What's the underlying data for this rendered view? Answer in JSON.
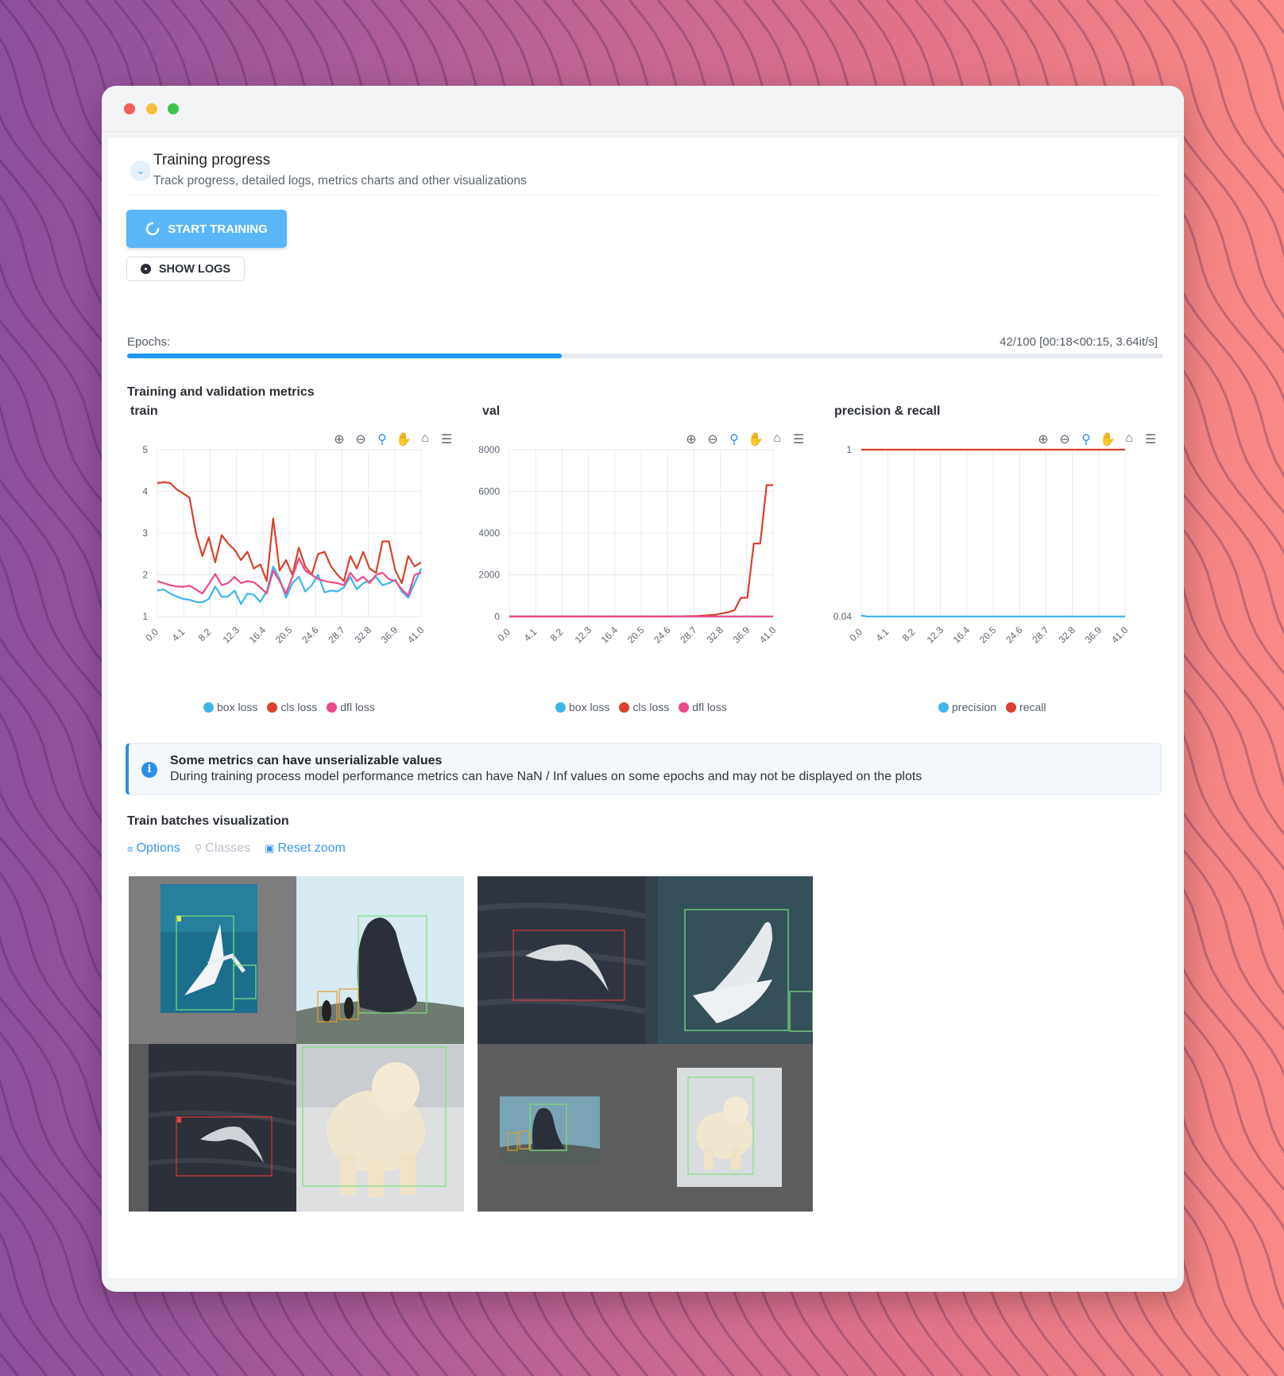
{
  "window": {
    "controls": [
      "close",
      "minimize",
      "maximize"
    ]
  },
  "section": {
    "title": "Training progress",
    "subtitle": "Track progress, detailed logs, metrics charts and other visualizations",
    "collapse_icon": "chevron-down-icon"
  },
  "buttons": {
    "start_training": "START TRAINING",
    "show_logs": "SHOW LOGS"
  },
  "progress": {
    "label": "Epochs:",
    "status": "42/100 [00:18<00:15, 3.64it/s]",
    "fraction": 0.42
  },
  "metrics": {
    "title": "Training and validation metrics"
  },
  "toolbar_icons": [
    "zoom-in-icon",
    "zoom-out-icon",
    "magnifier-icon",
    "pan-hand-icon",
    "home-icon",
    "menu-icon"
  ],
  "colors": {
    "accent": "#2196f3",
    "box_loss": "#3eb5ea",
    "cls_loss": "#d9412c",
    "dfl_loss": "#ec4a8a",
    "precision": "#3eb5ea",
    "recall": "#d9412c"
  },
  "chart_data": [
    {
      "type": "line",
      "title": "train",
      "x_ticks": [
        "0.0",
        "4.1",
        "8.2",
        "12.3",
        "16.4",
        "20.5",
        "24.6",
        "28.7",
        "32.8",
        "36.9",
        "41.0"
      ],
      "xlim": [
        0,
        41
      ],
      "y_ticks": [
        "1",
        "2",
        "3",
        "4",
        "5"
      ],
      "ylim": [
        1,
        5
      ],
      "grid": true,
      "legend": "bottom",
      "series": [
        {
          "name": "box loss",
          "color": "#3eb5ea",
          "values": [
            1.62,
            1.65,
            1.55,
            1.48,
            1.42,
            1.4,
            1.35,
            1.34,
            1.42,
            1.72,
            1.47,
            1.48,
            1.62,
            1.3,
            1.55,
            1.52,
            1.35,
            1.6,
            2.2,
            1.9,
            1.45,
            1.8,
            1.95,
            1.6,
            1.75,
            2.0,
            1.58,
            1.62,
            1.6,
            1.7,
            1.95,
            1.65,
            1.8,
            1.85,
            1.95,
            1.75,
            1.8,
            1.88,
            1.6,
            1.45,
            1.8,
            2.15
          ]
        },
        {
          "name": "cls loss",
          "color": "#d9412c",
          "values": [
            4.2,
            4.22,
            4.2,
            4.05,
            3.95,
            3.85,
            3.0,
            2.45,
            2.9,
            2.3,
            2.95,
            2.75,
            2.6,
            2.35,
            2.55,
            2.15,
            2.25,
            1.85,
            3.35,
            2.1,
            2.35,
            2.0,
            2.65,
            2.2,
            2.0,
            2.5,
            2.55,
            2.2,
            2.0,
            1.85,
            2.45,
            2.15,
            2.55,
            2.15,
            2.05,
            2.8,
            2.8,
            2.1,
            1.8,
            2.45,
            2.2,
            2.3
          ]
        },
        {
          "name": "dfl loss",
          "color": "#ec4a8a",
          "values": [
            1.85,
            1.8,
            1.75,
            1.72,
            1.71,
            1.74,
            1.65,
            1.55,
            1.78,
            2.02,
            1.75,
            1.8,
            1.95,
            1.8,
            1.85,
            1.82,
            1.7,
            1.55,
            2.1,
            1.85,
            1.55,
            1.95,
            2.4,
            2.1,
            2.0,
            1.9,
            1.85,
            1.82,
            1.8,
            1.75,
            2.05,
            1.85,
            1.95,
            1.8,
            2.0,
            2.05,
            1.9,
            1.85,
            1.65,
            1.5,
            2.0,
            2.05
          ]
        }
      ]
    },
    {
      "type": "line",
      "title": "val",
      "x_ticks": [
        "0.0",
        "4.1",
        "8.2",
        "12.3",
        "16.4",
        "20.5",
        "24.6",
        "28.7",
        "32.8",
        "36.9",
        "41.0"
      ],
      "xlim": [
        0,
        41
      ],
      "y_ticks": [
        "0",
        "2000",
        "4000",
        "6000",
        "8000"
      ],
      "ylim": [
        0,
        8000
      ],
      "grid": true,
      "legend": "bottom",
      "series": [
        {
          "name": "box loss",
          "color": "#3eb5ea",
          "values": [
            0,
            0,
            0,
            0,
            0,
            0,
            0,
            0,
            0,
            0,
            0,
            0,
            0,
            0,
            0,
            0,
            0,
            0,
            0,
            0,
            0,
            0,
            0,
            0,
            0,
            0,
            0,
            0,
            0,
            0,
            0,
            0,
            0,
            0,
            0,
            0,
            0,
            0,
            0,
            0,
            0,
            0
          ]
        },
        {
          "name": "cls loss",
          "color": "#d9412c",
          "values": [
            0,
            0,
            0,
            0,
            0,
            0,
            0,
            0,
            0,
            0,
            0,
            0,
            0,
            0,
            0,
            0,
            0,
            0,
            0,
            0,
            0,
            0,
            0,
            0,
            0,
            0,
            5,
            10,
            20,
            20,
            40,
            60,
            80,
            150,
            200,
            300,
            900,
            900,
            3500,
            3500,
            6300,
            6300
          ]
        },
        {
          "name": "dfl loss",
          "color": "#ec4a8a",
          "values": [
            0,
            0,
            0,
            0,
            0,
            0,
            0,
            0,
            0,
            0,
            0,
            0,
            0,
            0,
            0,
            0,
            0,
            0,
            0,
            0,
            0,
            0,
            0,
            0,
            0,
            0,
            0,
            0,
            0,
            0,
            0,
            0,
            0,
            0,
            0,
            0,
            0,
            0,
            0,
            0,
            0,
            0
          ]
        }
      ]
    },
    {
      "type": "line",
      "title": "precision & recall",
      "x_ticks": [
        "0.0",
        "4.1",
        "8.2",
        "12.3",
        "16.4",
        "20.5",
        "24.6",
        "28.7",
        "32.8",
        "36.9",
        "41.0"
      ],
      "xlim": [
        0,
        41
      ],
      "y_ticks": [
        "0.04",
        "1"
      ],
      "ylim": [
        0.04,
        1
      ],
      "grid": true,
      "legend": "bottom",
      "series": [
        {
          "name": "precision",
          "color": "#3eb5ea",
          "values": [
            0.045,
            0.04,
            0.04,
            0.04,
            0.04,
            0.04,
            0.04,
            0.04,
            0.04,
            0.04,
            0.04,
            0.04,
            0.04,
            0.04,
            0.04,
            0.04,
            0.04,
            0.04,
            0.04,
            0.04,
            0.04,
            0.04,
            0.04,
            0.04,
            0.04,
            0.04,
            0.04,
            0.04,
            0.04,
            0.04,
            0.04,
            0.04,
            0.04,
            0.04,
            0.04,
            0.04,
            0.04,
            0.04,
            0.04,
            0.04,
            0.04,
            0.04
          ]
        },
        {
          "name": "recall",
          "color": "#d9412c",
          "values": [
            1,
            1,
            1,
            1,
            1,
            1,
            1,
            1,
            1,
            1,
            1,
            1,
            1,
            1,
            1,
            1,
            1,
            1,
            1,
            1,
            1,
            1,
            1,
            1,
            1,
            1,
            1,
            1,
            1,
            1,
            1,
            1,
            1,
            1,
            1,
            1,
            1,
            1,
            1,
            1,
            1,
            1
          ]
        }
      ]
    }
  ],
  "notice": {
    "icon": "info-icon",
    "title": "Some metrics can have unserializable values",
    "text": "During training process model performance metrics can have NaN / Inf values on some epochs and may not be displayed on the plots"
  },
  "visualization": {
    "title": "Train batches visualization",
    "links": [
      {
        "label": "Options",
        "icon": "sliders-icon",
        "enabled": true
      },
      {
        "label": "Classes",
        "icon": "tags-icon",
        "enabled": false
      },
      {
        "label": "Reset zoom",
        "icon": "image-reset-icon",
        "enabled": true
      }
    ],
    "batches": [
      {
        "tiles": [
          "seagull",
          "seal-penguins",
          "seagull-dark",
          "polar-bear"
        ]
      },
      {
        "tiles": [
          "seagull-dark",
          "seagull-large",
          "seal-penguins-small",
          "polar-bear-small"
        ]
      }
    ]
  }
}
